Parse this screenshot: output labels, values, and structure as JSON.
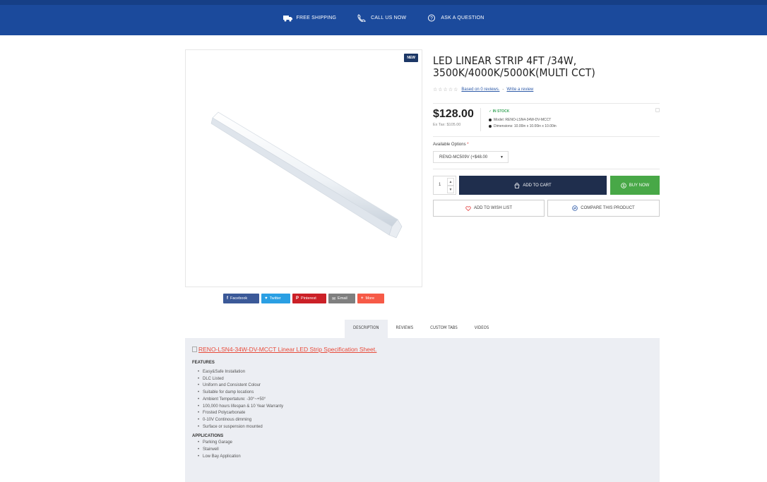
{
  "topbar": {
    "items": [
      {
        "icon": "truck-icon",
        "label": "FREE SHIPPING"
      },
      {
        "icon": "phone-icon",
        "label": "CALL US NOW"
      },
      {
        "icon": "question-icon",
        "label": "ASK A QUESTION"
      }
    ],
    "bg_color": "#1b4a9c"
  },
  "product": {
    "badge": "NEW",
    "title_line1": "LED LINEAR STRIP 4FT /34W,",
    "title_line2": "3500K/4000K/5000K(MULTI CCT)",
    "stars": "☆☆☆☆☆",
    "reviews_link": "Based on 0 reviews.",
    "reviews_sep": "-",
    "write_review": "Write a review",
    "price": "$128.00",
    "ex_tax": "Ex Tax: $105.00",
    "stock": "IN STOCK",
    "model": "Model: RENO-LSN4-34W-DV-MCCT",
    "dimensions": "Dimensions: 10.00in x 10.00in x 10.00in",
    "options_label": "Available Options",
    "options_required": "*",
    "option_selected": "RENO-MC509V (+$48.00",
    "quantity": "1",
    "add_to_cart": "ADD TO CART",
    "buy_now": "BUY NOW",
    "wish_list": "ADD TO WISH LIST",
    "compare": "COMPARE THIS PRODUCT"
  },
  "share": [
    {
      "name": "facebook",
      "glyph": "f",
      "label": "Facebook",
      "color": "#3b5998"
    },
    {
      "name": "twitter",
      "glyph": "♥",
      "label": "Twitter",
      "color": "#2a9fe3"
    },
    {
      "name": "pinterest",
      "glyph": "P",
      "label": "Pinterest",
      "color": "#cb2027"
    },
    {
      "name": "email",
      "glyph": "✉",
      "label": "Email",
      "color": "#7f7f7f"
    },
    {
      "name": "more",
      "glyph": "+",
      "label": "More",
      "color": "#f65a47"
    }
  ],
  "tabs": [
    {
      "label": "DESCRIPTION",
      "active": true
    },
    {
      "label": "REVIEWS",
      "active": false
    },
    {
      "label": "CUSTOM TABS",
      "active": false
    },
    {
      "label": "VIDEOS",
      "active": false
    }
  ],
  "description": {
    "spec_link": "RENO-LSN4-34W-DV-MCCT Linear LED Strip Specification Sheet.",
    "features_heading": "FEATURES",
    "features": [
      "Easy&Safe Installation",
      "DLC Listed",
      "Uniform and Consistent Colour",
      "Suitable for damp locations",
      "Ambient Tempertature: -30°~+50°",
      "100,000 hours lifespan & 10 Year Warranty",
      "Frosted Polycarbonate",
      "0-10V Continous dimming",
      "Surface or suspension mounted"
    ],
    "applications_heading": "APPLICATIONS",
    "applications": [
      "Parking Garage",
      "Stairwell",
      "Low Bay Application"
    ]
  }
}
